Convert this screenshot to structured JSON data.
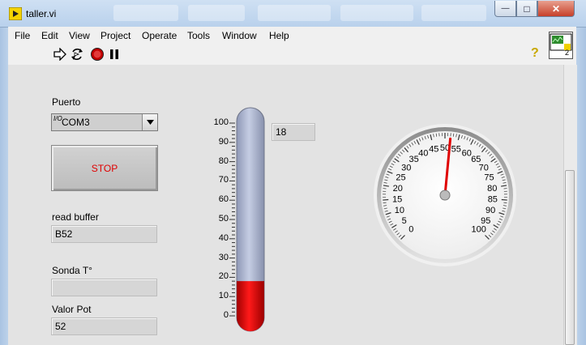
{
  "window": {
    "title": "taller.vi",
    "min_glyph": "—",
    "max_glyph": "□",
    "close_glyph": "✕"
  },
  "menu": [
    "File",
    "Edit",
    "View",
    "Project",
    "Operate",
    "Window",
    "Help"
  ],
  "menu_tools": "Tools",
  "toolbar": {
    "run_icon": "run-arrow-icon",
    "run_continuous_icon": "run-continuously-icon",
    "abort_icon": "abort-icon",
    "pause_icon": "pause-icon",
    "help_icon": "context-help-icon",
    "help_glyph": "?"
  },
  "vi_icon": {
    "number": "2"
  },
  "controls": {
    "puerto": {
      "label": "Puerto",
      "value": "COM3",
      "prefix": "I/O"
    },
    "stop": {
      "label": "STOP"
    },
    "read_buffer": {
      "label": "read buffer",
      "value": "B52"
    },
    "sonda": {
      "label": "Sonda T°",
      "value": ""
    },
    "valor_pot": {
      "label": "Valor Pot",
      "value": "52"
    }
  },
  "thermometer": {
    "value": 18,
    "display": "18",
    "min": 0,
    "max": 100,
    "ticks": [
      "0",
      "10",
      "20",
      "30",
      "40",
      "50",
      "60",
      "70",
      "80",
      "90",
      "100"
    ],
    "fill_color": "#e00000",
    "track_color": "#b7c0d8"
  },
  "gauge": {
    "value": 52,
    "min": 0,
    "max": 100,
    "ticks": [
      "0",
      "5",
      "10",
      "15",
      "20",
      "25",
      "30",
      "35",
      "40",
      "45",
      "50",
      "55",
      "60",
      "65",
      "70",
      "75",
      "80",
      "85",
      "90",
      "95",
      "100"
    ],
    "needle_color": "#e00000"
  },
  "colors": {
    "stop_text": "#e00000",
    "panel": "#e3e3e3"
  }
}
